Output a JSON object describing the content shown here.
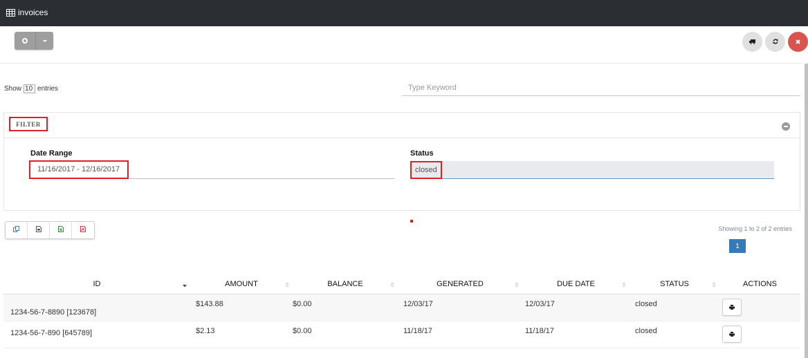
{
  "topbar": {
    "title": "invoices",
    "icon": "table-icon"
  },
  "toolbar": {
    "split_button": {
      "main_icon": "circle-icon",
      "dropdown_icon": "caret-down-icon"
    },
    "right_buttons": [
      {
        "name": "truck-button",
        "icon": "truck-icon"
      },
      {
        "name": "refresh-button",
        "icon": "refresh-icon"
      },
      {
        "name": "close-button",
        "icon": "close-icon",
        "color": "#d9534f"
      }
    ]
  },
  "length": {
    "prefix": "Show",
    "value": "10",
    "suffix": "entries"
  },
  "search": {
    "placeholder": "Type Keyword",
    "value": ""
  },
  "filter": {
    "title": "FILTER",
    "collapse_icon": "minus-circle-icon",
    "date_range": {
      "label": "Date Range",
      "value": "11/16/2017 - 12/16/2017"
    },
    "status": {
      "label": "Status",
      "value": "closed"
    }
  },
  "export_buttons": [
    {
      "name": "copy-button",
      "icon": "copy-icon",
      "color": "#3b7dbf"
    },
    {
      "name": "csv-button",
      "icon": "csv-file-icon",
      "color": "#555555"
    },
    {
      "name": "excel-button",
      "icon": "excel-file-icon",
      "color": "#2e8b3a"
    },
    {
      "name": "pdf-button",
      "icon": "pdf-file-icon",
      "color": "#e0303a"
    }
  ],
  "info": {
    "text": "Showing 1 to 2 of 2 entries"
  },
  "pagination": {
    "current": "1"
  },
  "table": {
    "columns": [
      "ID",
      "AMOUNT",
      "BALANCE",
      "GENERATED",
      "DUE DATE",
      "STATUS",
      "ACTIONS"
    ],
    "sort": {
      "column": "ID",
      "direction": "desc"
    },
    "rows": [
      {
        "id": "1234-56-7-8890 [123678]",
        "amount": "$143.88",
        "balance": "$0.00",
        "generated": "12/03/17",
        "due_date": "12/03/17",
        "status": "closed",
        "action_icon": "print-icon"
      },
      {
        "id": "1234-56-7-890 [645789]",
        "amount": "$2.13",
        "balance": "$0.00",
        "generated": "11/18/17",
        "due_date": "11/18/17",
        "status": "closed",
        "action_icon": "print-icon"
      }
    ]
  }
}
